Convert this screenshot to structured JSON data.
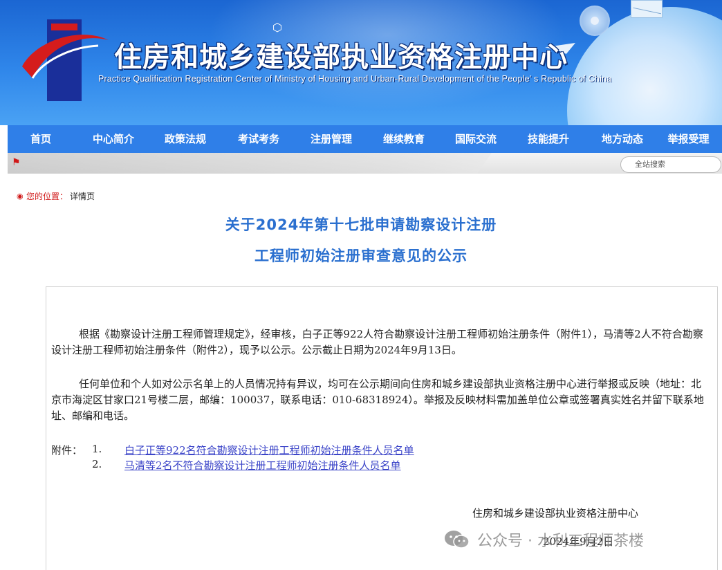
{
  "header": {
    "title_cn": "住房和城乡建设部执业资格注册中心",
    "title_en": "Practice Qualification Registration Center of Ministry of Housing and Urban-Rural Development of the People' s Republic of China"
  },
  "nav": {
    "items": [
      {
        "label": "首页"
      },
      {
        "label": "中心简介"
      },
      {
        "label": "政策法规"
      },
      {
        "label": "考试考务"
      },
      {
        "label": "注册管理"
      },
      {
        "label": "继续教育"
      },
      {
        "label": "国际交流"
      },
      {
        "label": "技能提升"
      },
      {
        "label": "地方动态"
      },
      {
        "label": "举报受理"
      }
    ]
  },
  "search": {
    "placeholder": "全站搜索"
  },
  "breadcrumb": {
    "label": "您的位置：",
    "current": "详情页"
  },
  "article": {
    "title_line1": "关于2024年第十七批申请勘察设计注册",
    "title_line2": "工程师初始注册审查意见的公示",
    "paragraph1": "根据《勘察设计注册工程师管理规定》，经审核，白子正等922人符合勘察设计注册工程师初始注册条件（附件1），马清等2人不符合勘察设计注册工程师初始注册条件（附件2），现予以公示。公示截止日期为2024年9月13日。",
    "paragraph2": "任何单位和个人如对公示名单上的人员情况持有异议，均可在公示期间向住房和城乡建设部执业资格注册中心进行举报或反映（地址：北京市海淀区甘家口21号楼二层，邮编：100037，联系电话：010-68318924）。举报及反映材料需加盖单位公章或签署真实姓名并留下联系地址、邮编和电话。",
    "attachments_label": "附件：",
    "attachments": [
      {
        "num": "1.",
        "text": "白子正等922名符合勘察设计注册工程师初始注册条件人员名单"
      },
      {
        "num": "2.",
        "text": "马清等2名不符合勘察设计注册工程师初始注册条件人员名单"
      }
    ],
    "signature_org": "住房和城乡建设部执业资格注册中心",
    "signature_date": "2024年9月2日"
  },
  "watermark": {
    "text": "公众号 · 水利工程师茶楼"
  },
  "colors": {
    "nav_bg": "#2f7fe8",
    "title_blue": "#2a6fcf",
    "link": "#3b44c8",
    "breadcrumb_red": "#d01818"
  }
}
